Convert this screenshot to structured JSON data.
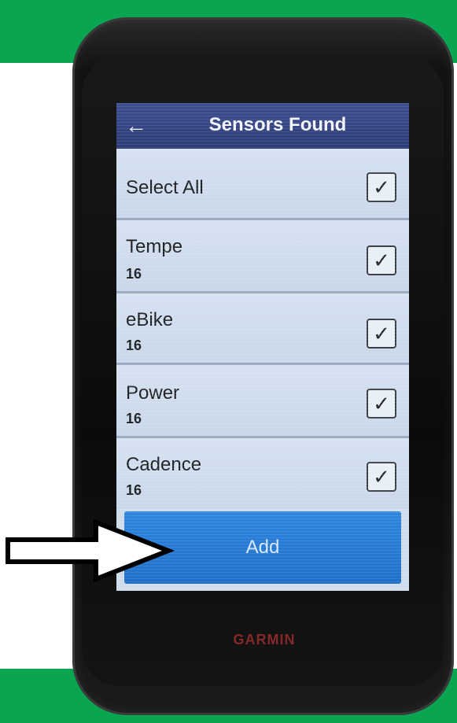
{
  "header": {
    "title": "Sensors Found",
    "back_icon": "arrow-left-icon"
  },
  "list": {
    "select_all": {
      "label": "Select All",
      "checked": true
    },
    "items": [
      {
        "label": "Tempe",
        "sub": "16",
        "checked": true
      },
      {
        "label": "eBike",
        "sub": "16",
        "checked": true
      },
      {
        "label": "Power",
        "sub": "16",
        "checked": true
      },
      {
        "label": "Cadence",
        "sub": "16",
        "checked": true
      }
    ]
  },
  "actions": {
    "add_label": "Add"
  },
  "device": {
    "brand": "GARMIN"
  },
  "colors": {
    "green_band": "#0aa550",
    "title_bar": "#2d3b76",
    "add_button": "#1f6fc8"
  }
}
